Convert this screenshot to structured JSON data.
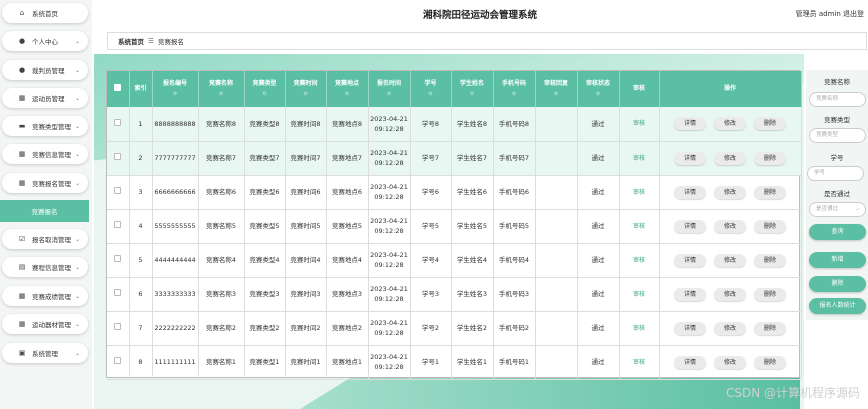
{
  "app_title": "湘科院田径运动会管理系统",
  "top_right": "管理员 admin  退出登",
  "breadcrumb": {
    "home": "系统首页",
    "sep": "☰",
    "current": "竞赛报名"
  },
  "sidebar": {
    "items": [
      {
        "label": "系统首页",
        "icon": "home-icon",
        "glyph": "⌂"
      },
      {
        "label": "个人中心",
        "icon": "user-icon",
        "glyph": "●"
      },
      {
        "label": "裁判员管理",
        "icon": "user-icon",
        "glyph": "●"
      },
      {
        "label": "运动员管理",
        "icon": "grid-icon",
        "glyph": "▦"
      },
      {
        "label": "竞赛类型管理",
        "icon": "briefcase-icon",
        "glyph": "▬"
      },
      {
        "label": "竞赛信息管理",
        "icon": "grid-icon",
        "glyph": "▦"
      },
      {
        "label": "竞赛报名管理",
        "icon": "grid-icon",
        "glyph": "▦"
      },
      {
        "label": "报名取消管理",
        "icon": "check-square-icon",
        "glyph": "☑"
      },
      {
        "label": "赛程信息管理",
        "icon": "calendar-icon",
        "glyph": "▤"
      },
      {
        "label": "竞赛成绩管理",
        "icon": "grid-icon",
        "glyph": "▦"
      },
      {
        "label": "运动器材管理",
        "icon": "grid-icon",
        "glyph": "▦"
      },
      {
        "label": "系统管理",
        "icon": "settings-icon",
        "glyph": "▣"
      }
    ],
    "active_sub": "竞赛报名"
  },
  "table": {
    "headers": [
      "索引",
      "报名编号",
      "竞赛名称",
      "竞赛类型",
      "竞赛时间",
      "竞赛地点",
      "报名时间",
      "学号",
      "学生姓名",
      "手机号码",
      "审核回复",
      "审核状态",
      "审核",
      "操作"
    ],
    "sort_mark": "≎",
    "review_link": "审核",
    "actions": {
      "detail": "详情",
      "edit": "修改",
      "delete": "删除"
    },
    "rows": [
      {
        "idx": "1",
        "no": "8888888888",
        "name": "竞赛名称8",
        "type": "竞赛类型8",
        "time": "竞赛时间8",
        "place": "竞赛地点8",
        "reg_time": "2023-04-21 09:12:28",
        "sid": "学号8",
        "sname": "学生姓名8",
        "phone": "手机号码8",
        "reply": "",
        "status": "通过"
      },
      {
        "idx": "2",
        "no": "7777777777",
        "name": "竞赛名称7",
        "type": "竞赛类型7",
        "time": "竞赛时间7",
        "place": "竞赛地点7",
        "reg_time": "2023-04-21 09:12:28",
        "sid": "学号7",
        "sname": "学生姓名7",
        "phone": "手机号码7",
        "reply": "",
        "status": "通过"
      },
      {
        "idx": "3",
        "no": "6666666666",
        "name": "竞赛名称6",
        "type": "竞赛类型6",
        "time": "竞赛时间6",
        "place": "竞赛地点6",
        "reg_time": "2023-04-21 09:12:28",
        "sid": "学号6",
        "sname": "学生姓名6",
        "phone": "手机号码6",
        "reply": "",
        "status": "通过"
      },
      {
        "idx": "4",
        "no": "5555555555",
        "name": "竞赛名称5",
        "type": "竞赛类型5",
        "time": "竞赛时间5",
        "place": "竞赛地点5",
        "reg_time": "2023-04-21 09:12:28",
        "sid": "学号5",
        "sname": "学生姓名5",
        "phone": "手机号码5",
        "reply": "",
        "status": "通过"
      },
      {
        "idx": "5",
        "no": "4444444444",
        "name": "竞赛名称4",
        "type": "竞赛类型4",
        "time": "竞赛时间4",
        "place": "竞赛地点4",
        "reg_time": "2023-04-21 09:12:28",
        "sid": "学号4",
        "sname": "学生姓名4",
        "phone": "手机号码4",
        "reply": "",
        "status": "通过"
      },
      {
        "idx": "6",
        "no": "3333333333",
        "name": "竞赛名称3",
        "type": "竞赛类型3",
        "time": "竞赛时间3",
        "place": "竞赛地点3",
        "reg_time": "2023-04-21 09:12:28",
        "sid": "学号3",
        "sname": "学生姓名3",
        "phone": "手机号码3",
        "reply": "",
        "status": "通过"
      },
      {
        "idx": "7",
        "no": "2222222222",
        "name": "竞赛名称2",
        "type": "竞赛类型2",
        "time": "竞赛时间2",
        "place": "竞赛地点2",
        "reg_time": "2023-04-21 09:12:28",
        "sid": "学号2",
        "sname": "学生姓名2",
        "phone": "手机号码2",
        "reply": "",
        "status": "通过"
      },
      {
        "idx": "8",
        "no": "1111111111",
        "name": "竞赛名称1",
        "type": "竞赛类型1",
        "time": "竞赛时间1",
        "place": "竞赛地点1",
        "reg_time": "2023-04-21 09:12:28",
        "sid": "学号1",
        "sname": "学生姓名1",
        "phone": "手机号码1",
        "reply": "",
        "status": "通过"
      }
    ]
  },
  "search": {
    "name_label": "竞赛名称",
    "name_placeholder": "竞赛名称",
    "type_label": "竞赛类型",
    "type_placeholder": "竞赛类型",
    "sid_label": "学号",
    "sid_placeholder": "学号",
    "pass_label": "是否通过",
    "pass_placeholder": "是否通过",
    "query_btn": "查询",
    "add_btn": "新增",
    "delete_btn": "删除",
    "stats_btn": "报名人数统计"
  },
  "watermark": "CSDN @计算机程序源码",
  "colors": {
    "accent": "#5bbfa3",
    "link": "#3aa57f"
  }
}
